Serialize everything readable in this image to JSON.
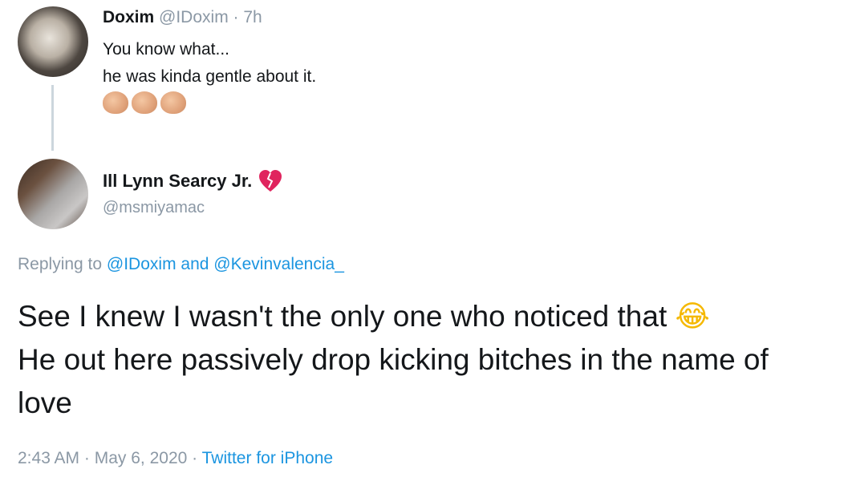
{
  "parent_tweet": {
    "display_name": "Doxim",
    "handle": "@IDoxim",
    "separator": "·",
    "time": "7h",
    "lines": [
      "You know what...",
      "he was kinda gentle about it."
    ],
    "emoji": "👏🏽👏🏽👏🏽"
  },
  "reply_tweet": {
    "display_name": "Ill Lynn Searcy Jr.",
    "name_emoji": "💔",
    "handle": "@msmiyamac",
    "replying_prefix": "Replying to",
    "replying_user1": "@IDoxim",
    "replying_and": "and",
    "replying_user2": "@Kevinvalencia_",
    "text_line1": "See I knew I wasn't the only one who noticed that",
    "text_emoji": "😂",
    "text_rest": "He out here passively drop kicking bitches in the name of love",
    "time": "2:43 AM",
    "separator1": "·",
    "date": "May 6, 2020",
    "separator2": "·",
    "source": "Twitter for iPhone"
  },
  "colors": {
    "text": "#14171a",
    "muted": "#8b98a5",
    "link": "#1b95e0",
    "thread_line": "#ccd6dd",
    "heart": "#e0245e"
  }
}
